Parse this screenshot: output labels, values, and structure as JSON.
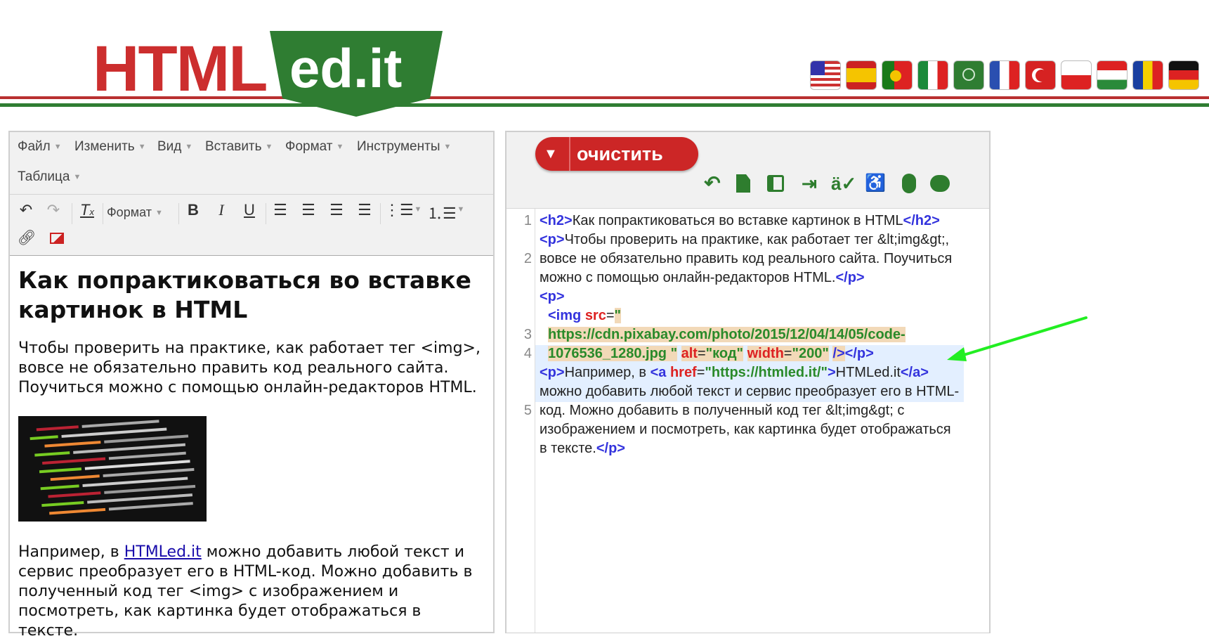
{
  "header": {
    "logo_left": "HTML",
    "logo_right": "ed.it",
    "flags": [
      "us-flag-icon",
      "es-flag-icon",
      "pt-flag-icon",
      "it-flag-icon",
      "sa-flag-icon",
      "fr-flag-icon",
      "tr-flag-icon",
      "pl-flag-icon",
      "hu-flag-icon",
      "ro-flag-icon",
      "de-flag-icon"
    ]
  },
  "editor": {
    "menu": [
      "Файл",
      "Изменить",
      "Вид",
      "Вставить",
      "Формат",
      "Инструменты",
      "Таблица"
    ],
    "format_dropdown": "Формат",
    "heading": "Как попрактиковаться во вставке картинок в HTML",
    "para1": "Чтобы проверить на практике, как работает тег <img>, вовсе не обязательно править код реального сайта. Поучиться можно с помощью онлайн-редакторов HTML.",
    "para2_before": "Например, в ",
    "para2_link": "HTMLed.it",
    "para2_after": " можно добавить любой текст и сервис преобразует его в HTML-код. Можно добавить в полученный код тег <img> с изображением и посмотреть, как картинка будет отображаться в тексте."
  },
  "code_panel": {
    "clear_button": "очистить",
    "line_numbers": [
      "1",
      "2",
      "3",
      "4",
      "5"
    ],
    "icons": [
      "undo-icon",
      "new-document-icon",
      "preview-icon",
      "indent-icon",
      "spellcheck-icon",
      "accessibility-icon",
      "mouse-icon",
      "chat-icon"
    ],
    "l1_open": "<h2>",
    "l1_text": "Как попрактиковаться во вставке картинок в HTML",
    "l1_close": "</h2>",
    "l2_open": "<p>",
    "l2_text": "Чтобы проверить на практике, как работает тег &lt;img&gt;, вовсе не обязательно править код реального сайта. Поучиться можно с помощью онлайн-редакторов HTML.",
    "l2_close": "</p>",
    "l3": "<p>",
    "l4_tag": "<img",
    "l4_src_attr": "src",
    "l4_src_val": "\" https://cdn.pixabay.com/photo/2015/12/04/14/05/code-1076536_1280.jpg \"",
    "l4_alt_attr": "alt",
    "l4_alt_val": "\"код\"",
    "l4_width_attr": "width",
    "l4_width_val": "\"200\"",
    "l4_end": "/>",
    "l4_close": "</p>",
    "l5_open": "<p>",
    "l5_text1": "Например, в ",
    "l5_a_open": "<a",
    "l5_href_attr": "href",
    "l5_href_val": "\"https://htmled.it/\"",
    "l5_gt": ">",
    "l5_link_text": "HTMLed.it",
    "l5_a_close": "</a>",
    "l5_text2": " можно добавить любой текст и сервис преобразует его в HTML-код. Можно добавить в полученный код тег &lt;img&gt; с изображением и посмотреть, как картинка будет отображаться в тексте.",
    "l5_close": "</p>"
  },
  "colors": {
    "brand_red": "#cc2e2e",
    "brand_green": "#2f7d32",
    "arrow": "#22ee22"
  }
}
